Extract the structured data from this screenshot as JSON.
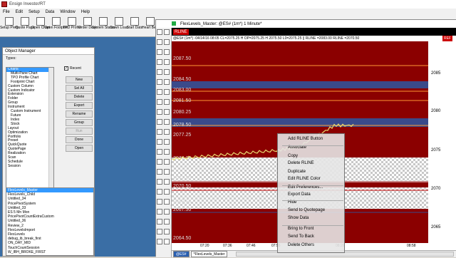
{
  "app": {
    "title": "Ensign Investor/RT"
  },
  "menu": [
    "File",
    "Edit",
    "Setup",
    "Data",
    "Window",
    "Help"
  ],
  "toolbar": [
    {
      "label": "Setup Prefs"
    },
    {
      "label": "Quote Page"
    },
    {
      "label": "Open Chart"
    },
    {
      "label": "Open Footprint"
    },
    {
      "label": "TPO Profile"
    },
    {
      "label": "Order Desk"
    },
    {
      "label": "System Status"
    },
    {
      "label": "Down Load"
    },
    {
      "label": "Start Data"
    },
    {
      "label": "Heart Beat"
    }
  ],
  "object_manager": {
    "title": "Object Manager",
    "types_label": "Types:",
    "recent_label": "Recent",
    "recent_checked": true,
    "types": [
      {
        "label": "Charts",
        "selected": true,
        "indent": false
      },
      {
        "label": "Multi-Pane Chart",
        "indent": true
      },
      {
        "label": "TPO Profile Chart",
        "indent": true
      },
      {
        "label": "Footprint Chart",
        "indent": true
      },
      {
        "label": "Custom Column",
        "indent": false
      },
      {
        "label": "Custom Indicator",
        "indent": false
      },
      {
        "label": "Extension",
        "indent": false
      },
      {
        "label": "Folder",
        "indent": false
      },
      {
        "label": "Group",
        "indent": false
      },
      {
        "label": "Instrument",
        "indent": false
      },
      {
        "label": "Custom Instrument",
        "indent": true
      },
      {
        "label": "Future",
        "indent": true
      },
      {
        "label": "Index",
        "indent": true
      },
      {
        "label": "Stock",
        "indent": true
      },
      {
        "label": "Layout",
        "indent": false
      },
      {
        "label": "Optimization",
        "indent": false
      },
      {
        "label": "Portfolio",
        "indent": false
      },
      {
        "label": "Preset",
        "indent": false
      },
      {
        "label": "QuickQuote",
        "indent": false
      },
      {
        "label": "QuotePage",
        "indent": false
      },
      {
        "label": "Realization",
        "indent": false
      },
      {
        "label": "Scan",
        "indent": false
      },
      {
        "label": "Schedule",
        "indent": false
      },
      {
        "label": "Session",
        "indent": false
      }
    ],
    "buttons": [
      {
        "label": "New",
        "disabled": false
      },
      {
        "label": "Sel All",
        "disabled": false
      },
      {
        "label": "Delete",
        "disabled": false
      },
      {
        "label": "Export",
        "disabled": false
      },
      {
        "label": "Rename",
        "disabled": false
      },
      {
        "label": "Group",
        "disabled": false
      },
      {
        "label": "Run",
        "disabled": true
      },
      {
        "label": "Done",
        "disabled": false
      },
      {
        "label": "Open",
        "disabled": false
      }
    ],
    "objects": [
      {
        "label": "FlexLevels_Master",
        "selected": true
      },
      {
        "label": "FlexLevels_Child"
      },
      {
        "label": "Untitled_34"
      },
      {
        "label": "PricePivotSystem"
      },
      {
        "label": "Untitled_33"
      },
      {
        "label": "ES 5 Mn Mon"
      },
      {
        "label": "PricePivotCountExtraCustom"
      },
      {
        "label": "Untitled_36"
      },
      {
        "label": "Review_2"
      },
      {
        "label": "FlexLevelsImport"
      },
      {
        "label": "FlexLevels"
      },
      {
        "label": "debug_ib_break_first"
      },
      {
        "label": "ON_DAY_MID"
      },
      {
        "label": "TouchCountSession"
      },
      {
        "label": "W_IBH_BROKE_FIRST"
      }
    ]
  },
  "chart_window": {
    "title": "FlexLevels_Master: @ES# (1m*) 1 Minute*",
    "rline_tag": "RLINE",
    "info_bar": "@ES# (1m*) -04/14/16 08:05 CL=2075.25 H OP=2075.25 H 2075.50 L0=2075.25  ||  RLINE  =2083.00  RLINE  =2070.50",
    "red_badge": "REF",
    "y_ticks": [
      "2085",
      "2080",
      "2075",
      "2070",
      "2065"
    ],
    "x_ticks": [
      "07:20",
      "07:36",
      "07:46",
      "07:55",
      "08:05",
      "08:26",
      "08:58"
    ],
    "price_labels": [
      "2087.50",
      "2084.50",
      "2083.00",
      "2081.50",
      "2080.25",
      "2078.50",
      "2077.25",
      "2074.25",
      "2071.50",
      "2070.50",
      "2068.50",
      "2067.50",
      "2064.50"
    ],
    "bottom_tab": "*FlexLevels_Master",
    "active_tab": "@ES#"
  },
  "context_menu": {
    "items": [
      {
        "label": "Add RLINE Button",
        "disabled": false
      },
      {
        "label": "Associate",
        "disabled": false
      },
      {
        "label": "Copy",
        "disabled": false
      },
      {
        "label": "Delete RLINE",
        "disabled": false
      },
      {
        "label": "Duplicate",
        "disabled": false
      },
      {
        "label": "Edit RLINE Color",
        "disabled": false
      },
      {
        "label": "Edit Preferences...",
        "disabled": false
      },
      {
        "label": "Export Data",
        "disabled": false
      },
      {
        "label": "Hide",
        "disabled": false
      },
      {
        "label": "Send to Quotepage",
        "disabled": false
      },
      {
        "label": "Show Data",
        "disabled": false
      },
      {
        "label": "Bring to Front",
        "disabled": false
      },
      {
        "label": "Send To Back",
        "disabled": false
      },
      {
        "label": "Delete Others",
        "disabled": false
      }
    ]
  },
  "colors": {
    "band_red": "#8b0000",
    "band_blue": "#3a4a8a",
    "line_orange": "#ff9933",
    "price_yellow": "#e8d870",
    "context_bg": "#e6e6e6"
  }
}
